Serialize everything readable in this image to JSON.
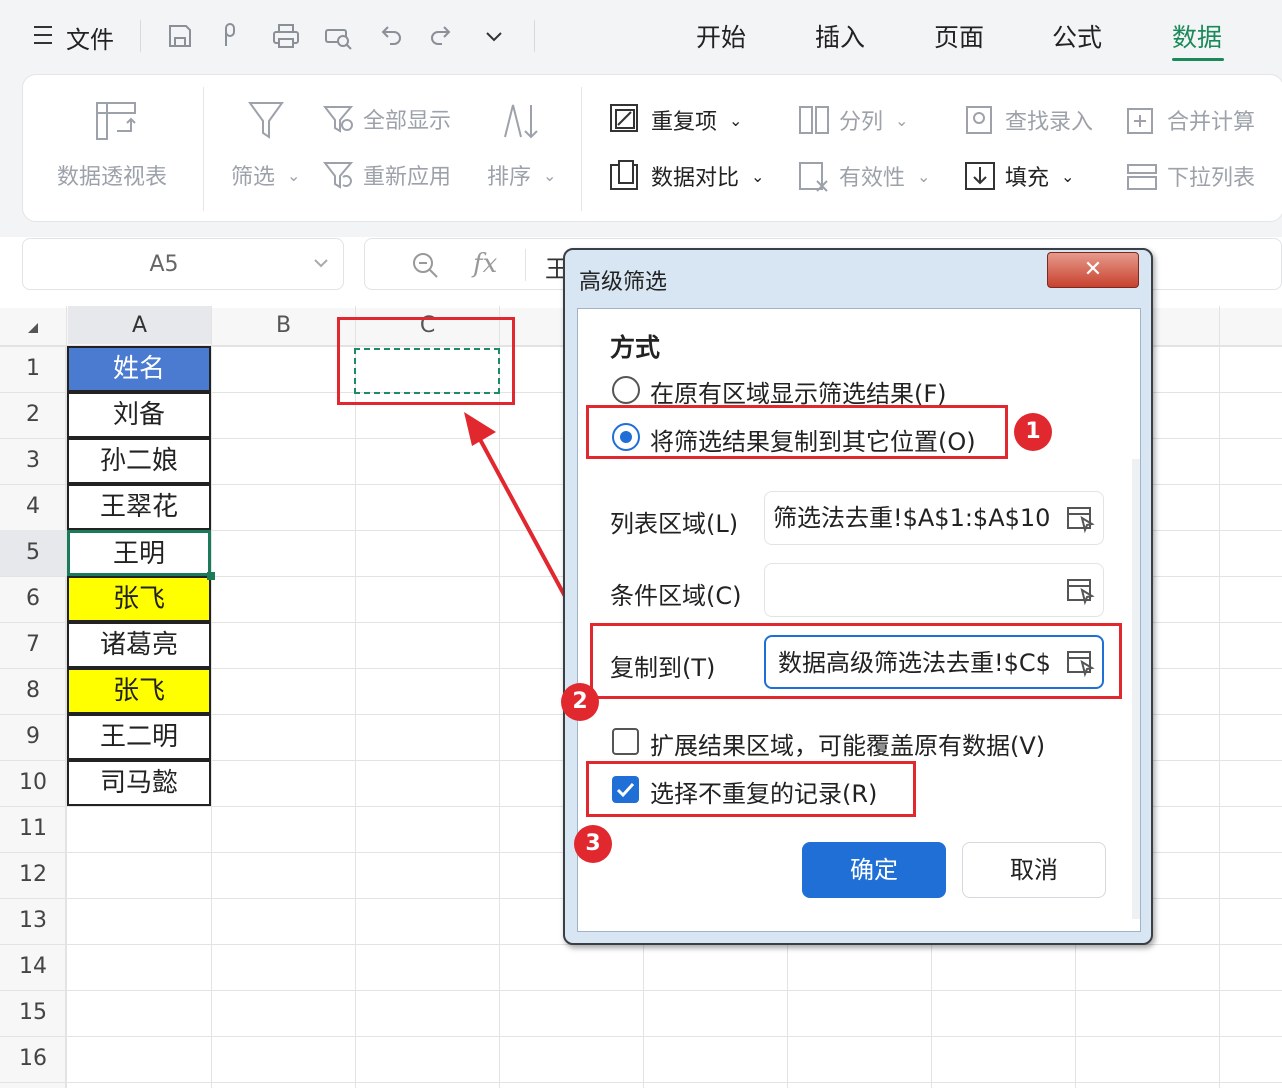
{
  "topbar": {
    "file_label": "文件",
    "tabs": [
      "开始",
      "插入",
      "页面",
      "公式",
      "数据"
    ],
    "active_tab": "数据",
    "accent": "#1b8a5a"
  },
  "ribbon": {
    "pivot": "数据透视表",
    "filter": "筛选",
    "show_all": "全部显示",
    "reapply": "重新应用",
    "sort": "排序",
    "duplicates": "重复项",
    "compare": "数据对比",
    "split": "分列",
    "validity": "有效性",
    "find_entry": "查找录入",
    "fill": "填充",
    "consolidate": "合并计算",
    "dropdown_list": "下拉列表"
  },
  "namebox": {
    "value": "A5"
  },
  "formula": {
    "fx": "fx",
    "content": "王"
  },
  "sheet": {
    "columns": [
      "A",
      "B",
      "C"
    ],
    "rows": [
      "1",
      "2",
      "3",
      "4",
      "5",
      "6",
      "7",
      "8",
      "9",
      "10",
      "11",
      "12",
      "13",
      "14",
      "15",
      "16"
    ],
    "cells": [
      "姓名",
      "刘备",
      "孙二娘",
      "王翠花",
      "王明",
      "张飞",
      "诸葛亮",
      "张飞",
      "王二明",
      "司马懿"
    ],
    "header_color": "#4a7bd0",
    "highlight_color": "#ffff00"
  },
  "dialog": {
    "title": "高级筛选",
    "close": "✕",
    "section": "方式",
    "opt_inplace": "在原有区域显示筛选结果(F)",
    "opt_copy": "将筛选结果复制到其它位置(O)",
    "list_label": "列表区域(L)",
    "list_value": "筛选法去重!$A$1:$A$10",
    "criteria_label": "条件区域(C)",
    "criteria_value": "",
    "copyto_label": "复制到(T)",
    "copyto_value": "数据高级筛选法去重!$C$",
    "expand_label": "扩展结果区域，可能覆盖原有数据(V)",
    "unique_label": "选择不重复的记录(R)",
    "ok": "确定",
    "cancel": "取消",
    "badges": [
      "1",
      "2",
      "3"
    ]
  }
}
